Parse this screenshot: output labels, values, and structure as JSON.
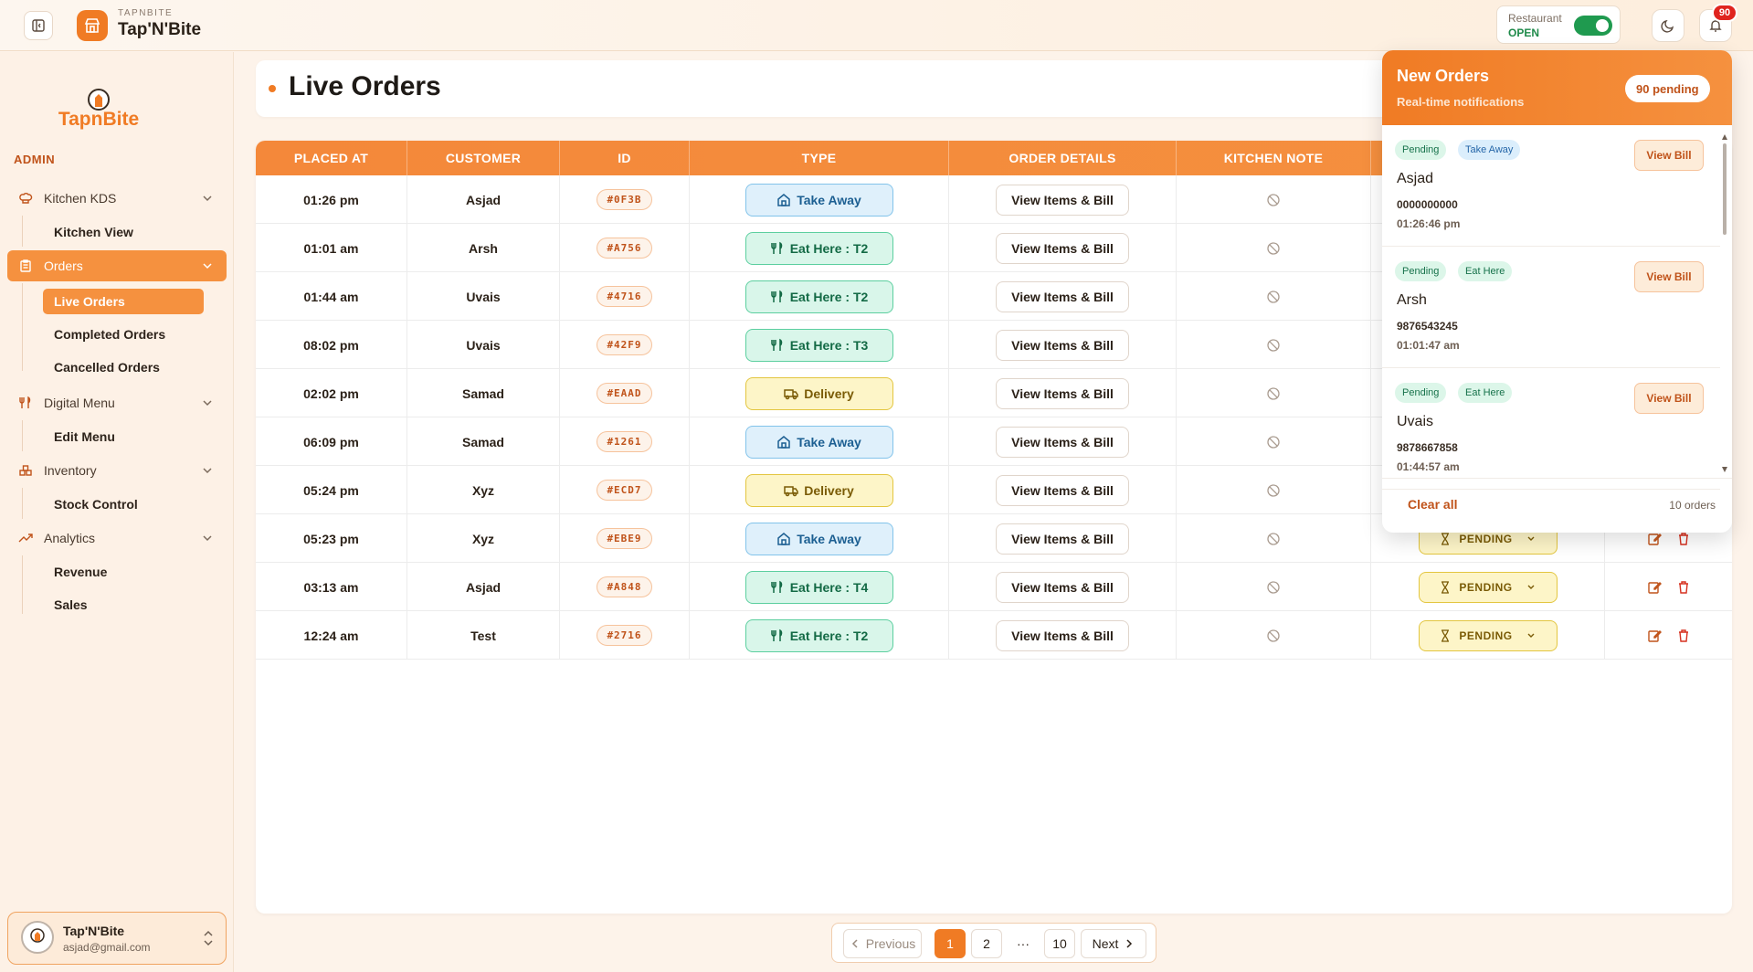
{
  "header": {
    "brand_sub": "TAPNBITE",
    "brand_title": "Tap'N'Bite",
    "restaurant_label": "Restaurant",
    "restaurant_status": "OPEN",
    "notification_badge": "90"
  },
  "sidebar": {
    "logo_text": "TapnBite",
    "section": "ADMIN",
    "kitchen_group": "Kitchen KDS",
    "kitchen_view": "Kitchen View",
    "orders_group": "Orders",
    "live_orders": "Live Orders",
    "completed_orders": "Completed Orders",
    "cancelled_orders": "Cancelled Orders",
    "menu_group": "Digital Menu",
    "edit_menu": "Edit Menu",
    "inventory_group": "Inventory",
    "stock_control": "Stock Control",
    "analytics_group": "Analytics",
    "revenue": "Revenue",
    "sales": "Sales"
  },
  "user": {
    "name": "Tap'N'Bite",
    "email": "asjad@gmail.com"
  },
  "page": {
    "title": "Live Orders"
  },
  "table": {
    "headers": [
      "PLACED AT",
      "CUSTOMER",
      "ID",
      "TYPE",
      "ORDER DETAILS",
      "KITCHEN NOTE",
      "",
      ""
    ],
    "view_label": "View Items & Bill",
    "status_label": "PENDING",
    "rows": [
      {
        "time": "01:26 pm",
        "customer": "Asjad",
        "id": "#0F3B",
        "type": "Take Away",
        "type_kind": "take"
      },
      {
        "time": "01:01 am",
        "customer": "Arsh",
        "id": "#A756",
        "type": "Eat Here : T2",
        "type_kind": "eat"
      },
      {
        "time": "01:44 am",
        "customer": "Uvais",
        "id": "#4716",
        "type": "Eat Here : T2",
        "type_kind": "eat"
      },
      {
        "time": "08:02 pm",
        "customer": "Uvais",
        "id": "#42F9",
        "type": "Eat Here : T3",
        "type_kind": "eat"
      },
      {
        "time": "02:02 pm",
        "customer": "Samad",
        "id": "#EAAD",
        "type": "Delivery",
        "type_kind": "del"
      },
      {
        "time": "06:09 pm",
        "customer": "Samad",
        "id": "#1261",
        "type": "Take Away",
        "type_kind": "take"
      },
      {
        "time": "05:24 pm",
        "customer": "Xyz",
        "id": "#ECD7",
        "type": "Delivery",
        "type_kind": "del"
      },
      {
        "time": "05:23 pm",
        "customer": "Xyz",
        "id": "#EBE9",
        "type": "Take Away",
        "type_kind": "take",
        "status": "PENDING"
      },
      {
        "time": "03:13 am",
        "customer": "Asjad",
        "id": "#A848",
        "type": "Eat Here : T4",
        "type_kind": "eat",
        "status": "PENDING"
      },
      {
        "time": "12:24 am",
        "customer": "Test",
        "id": "#2716",
        "type": "Eat Here : T2",
        "type_kind": "eat",
        "status": "PENDING"
      }
    ]
  },
  "pagination": {
    "previous": "Previous",
    "pages": [
      "1",
      "2"
    ],
    "ellipsis": "···",
    "last": "10",
    "next": "Next",
    "current": "1"
  },
  "notifications": {
    "title": "New Orders",
    "subtitle": "Real-time notifications",
    "count": "90 pending",
    "items": [
      {
        "status": "Pending",
        "type": "Take Away",
        "name": "Asjad",
        "phone": "0000000000",
        "time": "01:26:46 pm",
        "action": "View Bill"
      },
      {
        "status": "Pending",
        "type": "Eat Here",
        "name": "Arsh",
        "phone": "9876543245",
        "time": "01:01:47 am",
        "action": "View Bill"
      },
      {
        "status": "Pending",
        "type": "Eat Here",
        "name": "Uvais",
        "phone": "9878667858",
        "time": "01:44:57 am",
        "action": "View Bill"
      }
    ],
    "clear_all": "Clear all",
    "total": "10 orders"
  },
  "colors": {
    "accent": "#f07b24",
    "take_away": "#1c5f92",
    "eat_here": "#136a45",
    "delivery": "#7a5b06"
  }
}
